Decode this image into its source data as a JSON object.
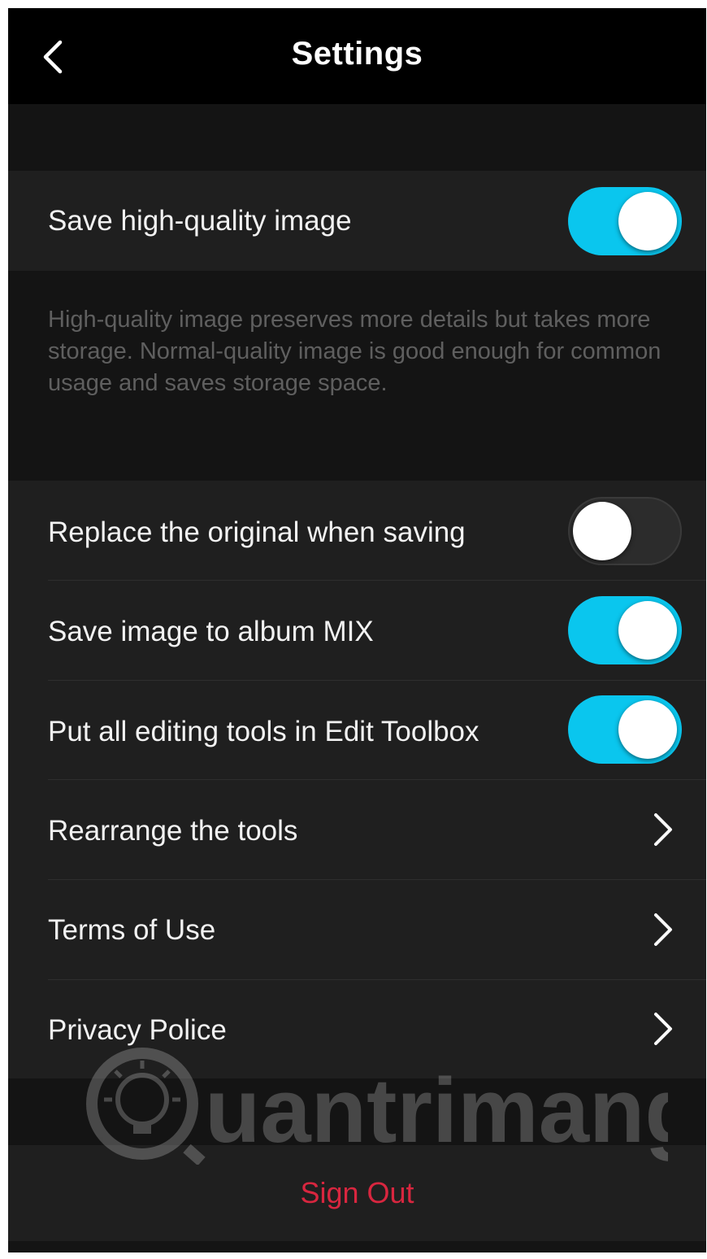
{
  "header": {
    "title": "Settings",
    "back_icon": "chevron-left-icon"
  },
  "settings": {
    "save_hq": {
      "label": "Save high-quality image",
      "enabled": true
    },
    "description": "High-quality image preserves more details but takes more storage. Normal-quality image is good enough for common usage and saves storage space.",
    "replace_original": {
      "label": "Replace the original when saving",
      "enabled": false
    },
    "save_album": {
      "label": "Save image to album MIX",
      "enabled": true
    },
    "edit_toolbox": {
      "label": "Put all editing tools in Edit Toolbox",
      "enabled": true
    },
    "rearrange": {
      "label": "Rearrange the tools"
    },
    "terms": {
      "label": "Terms of Use"
    },
    "privacy": {
      "label": "Privacy Police"
    }
  },
  "sign_out": {
    "label": "Sign Out"
  },
  "watermark": {
    "text": "uantrimang"
  },
  "colors": {
    "toggle_on": "#0ac6ee",
    "sign_out": "#d8263f",
    "background": "#141414",
    "row_background": "#1f1f1f"
  }
}
